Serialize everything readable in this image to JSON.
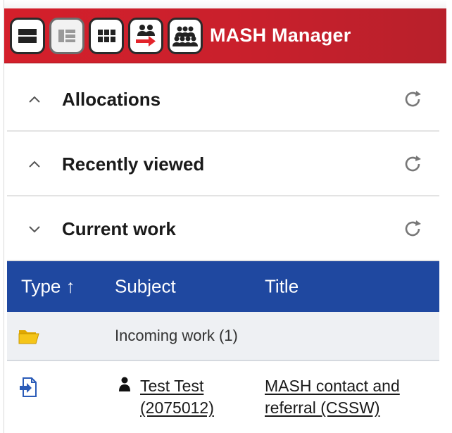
{
  "header": {
    "app_title": "MASH Manager",
    "buttons": [
      {
        "icon": "single-row-layout-icon"
      },
      {
        "icon": "list-layout-icon"
      },
      {
        "icon": "grid-layout-icon"
      },
      {
        "icon": "people-transfer-icon"
      },
      {
        "icon": "team-icon"
      }
    ],
    "colors": {
      "brand": "#d41f2b",
      "table_header": "#1f48a0"
    }
  },
  "sections": [
    {
      "title": "Allocations",
      "expanded": false
    },
    {
      "title": "Recently viewed",
      "expanded": false
    },
    {
      "title": "Current work",
      "expanded": true
    }
  ],
  "table": {
    "columns": [
      {
        "label": "Type",
        "sort_indicator": "↑"
      },
      {
        "label": "Subject"
      },
      {
        "label": "Title"
      }
    ],
    "group": {
      "label": "Incoming work (1)"
    },
    "rows": [
      {
        "subject_line1": "Test Test",
        "subject_line2": "(2075012)",
        "title_line1": "MASH contact and",
        "title_line2": "referral (CSSW)"
      }
    ]
  }
}
